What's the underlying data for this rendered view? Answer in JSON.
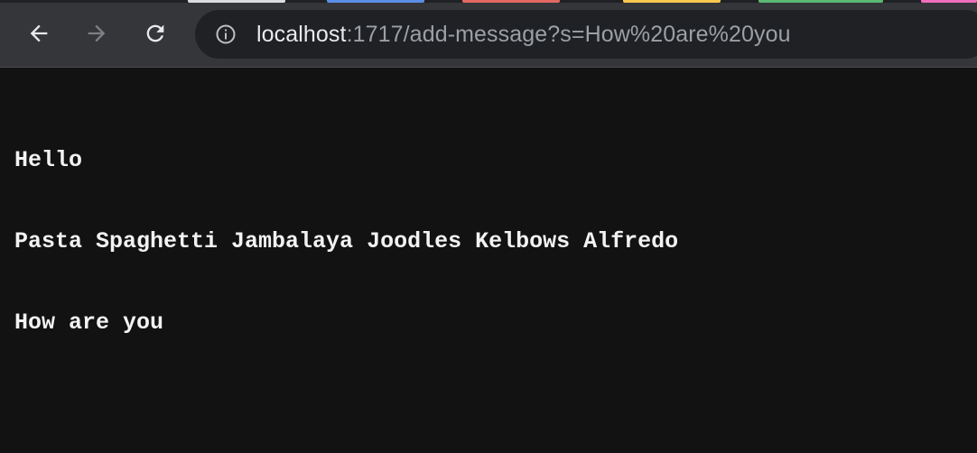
{
  "browser": {
    "tab_colors": [
      "#dadce0",
      "#5b8ee6",
      "#e46962",
      "#f9c74f",
      "#5bb974",
      "#ef6ebd"
    ],
    "back_icon": "arrow-left-icon",
    "forward_icon": "arrow-right-icon",
    "reload_icon": "reload-icon",
    "site_info_icon": "info-circle-icon",
    "address_bar": {
      "host": "localhost",
      "rest": ":1717/add-message?s=How%20are%20you"
    }
  },
  "page": {
    "lines": [
      "Hello",
      "Pasta Spaghetti Jambalaya Joodles Kelbows Alfredo",
      "How are you"
    ]
  }
}
